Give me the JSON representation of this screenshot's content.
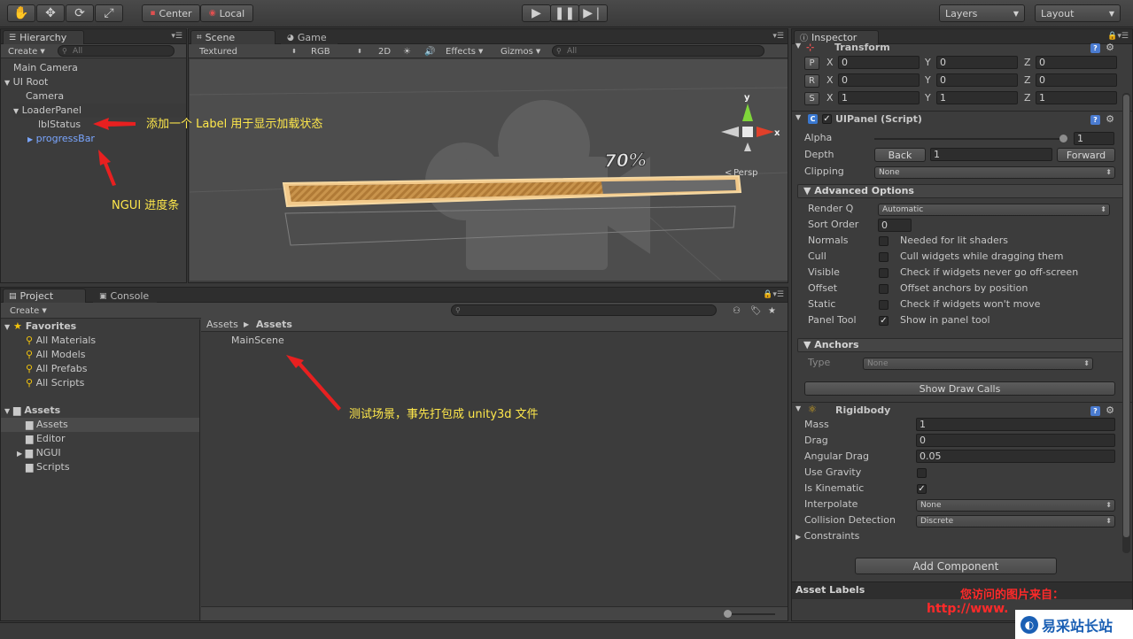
{
  "toolbar": {
    "tools": [
      "hand-icon",
      "move-icon",
      "rotate-icon",
      "scale-icon"
    ],
    "pivot": "Center",
    "space": "Local",
    "layers": "Layers",
    "layout": "Layout"
  },
  "hierarchy": {
    "tab": "Hierarchy",
    "create": "Create",
    "search_placeholder": "All",
    "items": [
      "Main Camera",
      "UI Root",
      "Camera",
      "LoaderPanel",
      "lblStatus",
      "progressBar"
    ]
  },
  "scene": {
    "tabs": [
      "Scene",
      "Game"
    ],
    "render_mode": "Textured",
    "color_mode": "RGB",
    "mode_2d": "2D",
    "effects": "Effects",
    "gizmos": "Gizmos",
    "search_placeholder": "All",
    "progress_label": "70%",
    "progress_value": 0.7,
    "persp": "Persp",
    "axes": {
      "x": "x",
      "y": "y"
    }
  },
  "project": {
    "tabs": [
      "Project",
      "Console"
    ],
    "create": "Create",
    "favorites_title": "Favorites",
    "favorites": [
      "All Materials",
      "All Models",
      "All Prefabs",
      "All Scripts"
    ],
    "assets_title": "Assets",
    "folders": [
      "Assets",
      "Editor",
      "NGUI",
      "Scripts"
    ],
    "breadcrumb": [
      "Assets",
      "Assets"
    ],
    "files": [
      "MainScene"
    ]
  },
  "annotations": {
    "label_note": "添加一个 Label 用于显示加载状态",
    "progress_note": "NGUI 进度条",
    "scene_note": "测试场景，事先打包成 unity3d 文件"
  },
  "inspector": {
    "tab": "Inspector",
    "transform": {
      "title": "Transform",
      "position": {
        "x": "0",
        "y": "0",
        "z": "0"
      },
      "rotation": {
        "x": "0",
        "y": "0",
        "z": "0"
      },
      "scale": {
        "x": "1",
        "y": "1",
        "z": "1"
      }
    },
    "uipanel": {
      "title": "UIPanel (Script)",
      "alpha_label": "Alpha",
      "alpha_value": "1",
      "depth_label": "Depth",
      "back": "Back",
      "depth_value": "1",
      "forward": "Forward",
      "clipping_label": "Clipping",
      "clipping_value": "None",
      "advanced_title": "Advanced Options",
      "render_q_label": "Render Q",
      "render_q_value": "Automatic",
      "sort_order_label": "Sort Order",
      "sort_order_value": "0",
      "options": [
        {
          "label": "Normals",
          "desc": "Needed for lit shaders",
          "checked": false
        },
        {
          "label": "Cull",
          "desc": "Cull widgets while dragging them",
          "checked": false
        },
        {
          "label": "Visible",
          "desc": "Check if widgets never go off-screen",
          "checked": false
        },
        {
          "label": "Offset",
          "desc": "Offset anchors by position",
          "checked": false
        },
        {
          "label": "Static",
          "desc": "Check if widgets won't move",
          "checked": false
        },
        {
          "label": "Panel Tool",
          "desc": "Show in panel tool",
          "checked": true
        }
      ],
      "anchors_title": "Anchors",
      "type_label": "Type",
      "type_value": "None",
      "show_draw_calls": "Show Draw Calls"
    },
    "rigidbody": {
      "title": "Rigidbody",
      "mass_label": "Mass",
      "mass": "1",
      "drag_label": "Drag",
      "drag": "0",
      "angular_drag_label": "Angular Drag",
      "angular_drag": "0.05",
      "use_gravity_label": "Use Gravity",
      "use_gravity": false,
      "is_kinematic_label": "Is Kinematic",
      "is_kinematic": true,
      "interpolate_label": "Interpolate",
      "interpolate": "None",
      "collision_label": "Collision Detection",
      "collision": "Discrete",
      "constraints_label": "Constraints"
    },
    "add_component": "Add Component",
    "asset_labels": "Asset Labels"
  },
  "watermark": {
    "line1": "您访问的图片来自：",
    "url": "http://www.",
    "site": "易采站长站"
  }
}
